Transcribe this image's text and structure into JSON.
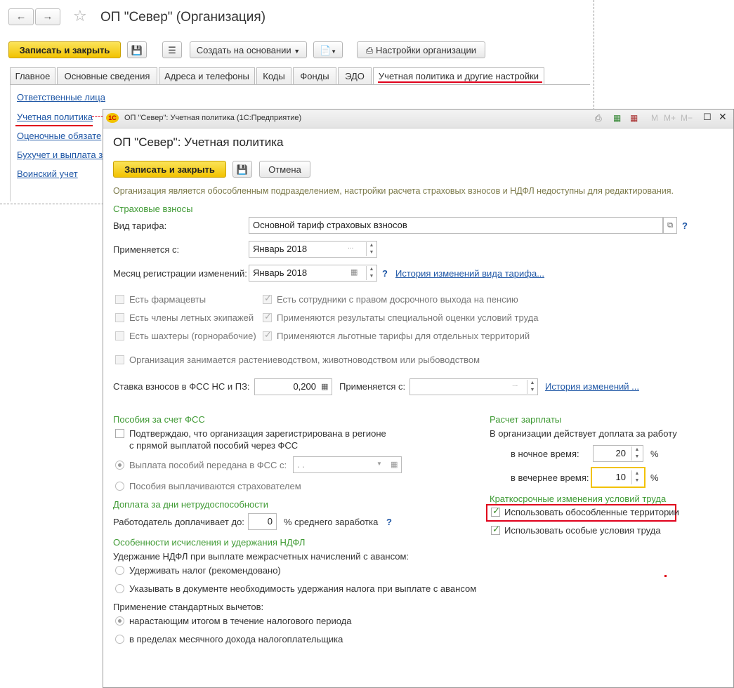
{
  "back": {
    "title": "ОП \"Север\" (Организация)",
    "save_close": "Записать и закрыть",
    "create_based": "Создать на основании",
    "org_settings": "Настройки организации",
    "tabs": [
      "Главное",
      "Основные сведения",
      "Адреса и телефоны",
      "Коды",
      "Фонды",
      "ЭДО",
      "Учетная политика и другие настройки"
    ],
    "links": [
      "Ответственные лица",
      "Учетная политика",
      "Оценочные обязате",
      "Бухучет и выплата з",
      "Воинский учет"
    ]
  },
  "front": {
    "window_title": "ОП \"Север\": Учетная политика  (1С:Предприятие)",
    "titlebar_icons": [
      "M",
      "M+",
      "M−"
    ],
    "heading": "ОП \"Север\": Учетная политика",
    "save_close": "Записать и закрыть",
    "cancel": "Отмена",
    "notice": "Организация является обособленным подразделением, настройки расчета страховых взносов и НДФЛ недоступны для редактирования.",
    "insurance": {
      "section": "Страховые взносы",
      "tariff_label": "Вид тарифа:",
      "tariff_value": "Основной тариф страховых взносов",
      "applies_label": "Применяется с:",
      "applies_value": "Январь 2018",
      "reg_month_label": "Месяц регистрации изменений:",
      "reg_month_value": "Январь 2018",
      "tariff_history_link": "История изменений вида тарифа...",
      "help": "?",
      "checkboxes_left": [
        "Есть фармацевты",
        "Есть члены летных экипажей",
        "Есть шахтеры (горнорабочие)"
      ],
      "checkboxes_right": [
        "Есть сотрудники с правом досрочного выхода на пенсию",
        "Применяются результаты специальной оценки условий труда",
        "Применяются льготные тарифы для отдельных территорий"
      ],
      "agro": "Организация занимается растениеводством, животноводством или рыбоводством",
      "fss_rate_label": "Ставка взносов в ФСС НС и ПЗ:",
      "fss_rate_value": "0,200",
      "fss_applies_label": "Применяется с:",
      "fss_history_link": "История изменений ..."
    },
    "benefits": {
      "section": "Пособия за счет ФСС",
      "confirm_line1": "Подтверждаю, что организация зарегистрирована в регионе",
      "confirm_line2": "с прямой выплатой пособий через ФСС",
      "transferred": "Выплата пособий передана в ФСС с:",
      "date_placeholder": " .  .",
      "by_insurer": "Пособия выплачиваются страхователем"
    },
    "sick": {
      "section": "Доплата за дни нетрудоспособности",
      "employer_label": "Работодатель доплачивает до:",
      "employer_value": "0",
      "suffix": "% среднего заработка"
    },
    "ndfl": {
      "section": "Особенности исчисления и удержания НДФЛ",
      "withholding_label": "Удержание НДФЛ при выплате межрасчетных начислений с авансом:",
      "withholding_opts": [
        "Удерживать налог (рекомендовано)",
        "Указывать в документе необходимость удержания налога при выплате с авансом"
      ],
      "deductions_label": "Применение стандартных вычетов:",
      "deductions_opts": [
        "нарастающим итогом в течение налогового периода",
        "в пределах месячного дохода налогоплательщика"
      ]
    },
    "salary": {
      "section": "Расчет зарплаты",
      "extra_label": "В организации действует доплата за работу",
      "night_label": "в ночное время:",
      "night_value": "20",
      "evening_label": "в вечернее время:",
      "evening_value": "10",
      "percent": "%"
    },
    "short_term": {
      "section": "Краткосрочные изменения условий труда",
      "separate_territories": "Использовать обособленные территории",
      "special_conditions": "Использовать особые условия труда"
    }
  },
  "colors": {
    "accent_yellow": "#f2c200",
    "link": "#1f57a6",
    "section_green": "#3f9a34",
    "highlight_red": "#e0001b"
  }
}
